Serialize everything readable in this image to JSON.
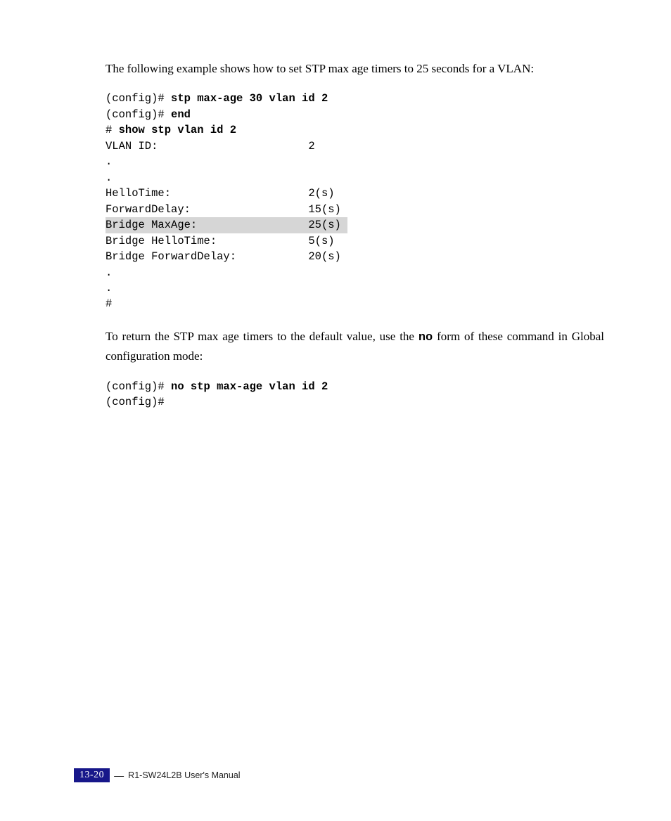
{
  "para1": "The following example shows how to set STP max age timers to 25 seconds for a VLAN:",
  "code1": {
    "l1_prompt": "(config)# ",
    "l1_cmd": "stp max-age 30 vlan id 2",
    "l2_prompt": "(config)# ",
    "l2_cmd": "end",
    "l3_prompt": "# ",
    "l3_cmd": "show stp vlan id 2",
    "blank": "",
    "r1": "VLAN ID:                       2",
    "r2": ".",
    "r3": ".",
    "r4": "HelloTime:                     2(s)",
    "r5": "ForwardDelay:                  15(s)",
    "r6_label": "Bridge MaxAge:                 25(s) ",
    "r7": "Bridge HelloTime:              5(s)",
    "r8": "Bridge ForwardDelay:           20(s)",
    "r9": ".",
    "r10": ".",
    "r11": "#"
  },
  "para2_pre": "To return the STP max age timers to the default value, use the ",
  "para2_bold": "no",
  "para2_post": " form of these command in Global configuration mode:",
  "code2": {
    "l1_prompt": "(config)# ",
    "l1_cmd": "no stp max-age vlan id 2",
    "l2": "(config)#"
  },
  "footer": {
    "page_num": "13-20",
    "text": "R1-SW24L2B    User's Manual"
  }
}
